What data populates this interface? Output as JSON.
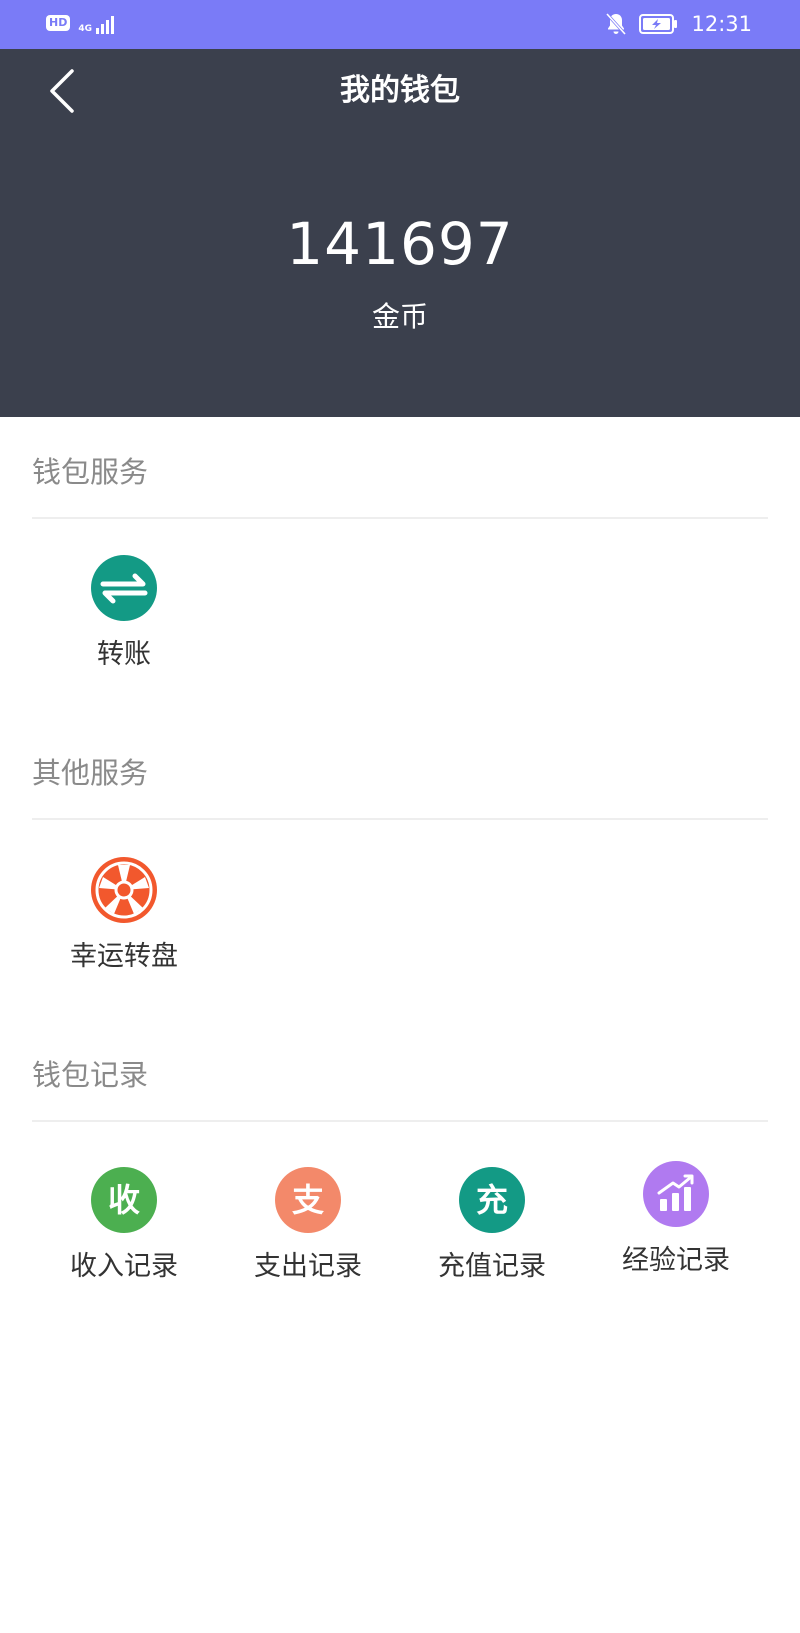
{
  "status_bar": {
    "hd": "HD",
    "network": "4G",
    "time": "12:31"
  },
  "header": {
    "title": "我的钱包",
    "balance": "141697",
    "currency_label": "金币"
  },
  "sections": {
    "wallet_services": {
      "title": "钱包服务",
      "items": [
        {
          "label": "转账",
          "icon": "transfer-icon",
          "color": "#139a85"
        }
      ]
    },
    "other_services": {
      "title": "其他服务",
      "items": [
        {
          "label": "幸运转盘",
          "icon": "wheel-icon",
          "color": "#f2582d"
        }
      ]
    },
    "wallet_records": {
      "title": "钱包记录",
      "items": [
        {
          "label": "收入记录",
          "icon_text": "收",
          "icon": "income-icon",
          "color": "#4caf50"
        },
        {
          "label": "支出记录",
          "icon_text": "支",
          "icon": "expense-icon",
          "color": "#f3896a"
        },
        {
          "label": "充值记录",
          "icon_text": "充",
          "icon": "recharge-icon",
          "color": "#139a85"
        },
        {
          "label": "经验记录",
          "icon": "chart-bars-icon",
          "color": "#b07af0"
        }
      ]
    }
  }
}
